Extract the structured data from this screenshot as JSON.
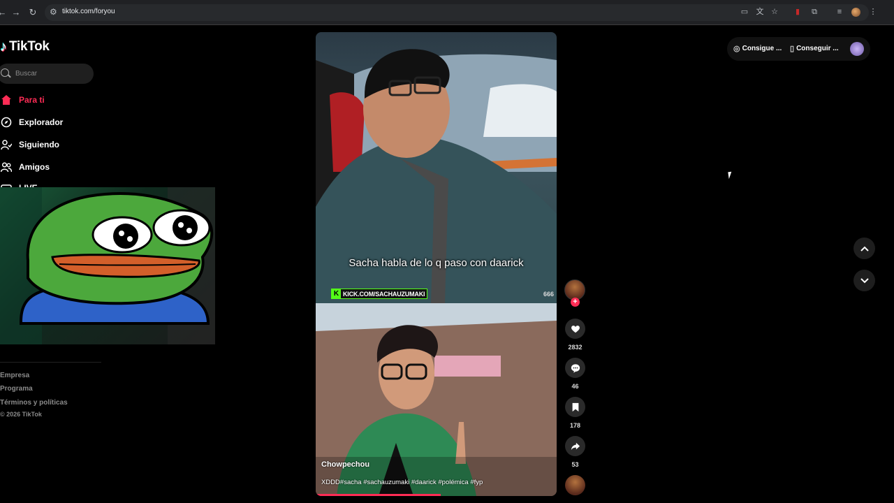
{
  "browser": {
    "url": "tiktok.com/foryou"
  },
  "sidebar": {
    "logo_text": "TikTok",
    "search_placeholder": "Buscar",
    "nav": [
      {
        "label": "Para ti",
        "icon": "home-icon",
        "active": true
      },
      {
        "label": "Explorador",
        "icon": "compass-icon",
        "active": false
      },
      {
        "label": "Siguiendo",
        "icon": "following-icon",
        "active": false
      },
      {
        "label": "Amigos",
        "icon": "friends-icon",
        "active": false
      },
      {
        "label": "LIVE",
        "icon": "live-icon",
        "active": false
      }
    ],
    "footer_links": [
      "Empresa",
      "Programa",
      "Términos y políticas"
    ],
    "copyright": "© 2026 TikTok"
  },
  "top_actions": {
    "coins_label": "Consigue ...",
    "app_label": "Conseguir ..."
  },
  "video": {
    "caption": "Sacha habla de lo q paso con daarick",
    "kick_handle": "KICK.COM/SACHAUZUMAKI",
    "counter": "666",
    "author": "Chowpechou",
    "description": "XDDD#sacha #sachauzumaki #daarick #polémica #fyp",
    "progress": 0.52
  },
  "actions": {
    "likes": "2832",
    "comments": "46",
    "saves": "178",
    "shares": "53"
  },
  "colors": {
    "accent": "#fe2c55",
    "kick_green": "#53fc18",
    "pepe_green": "#3cb043"
  }
}
